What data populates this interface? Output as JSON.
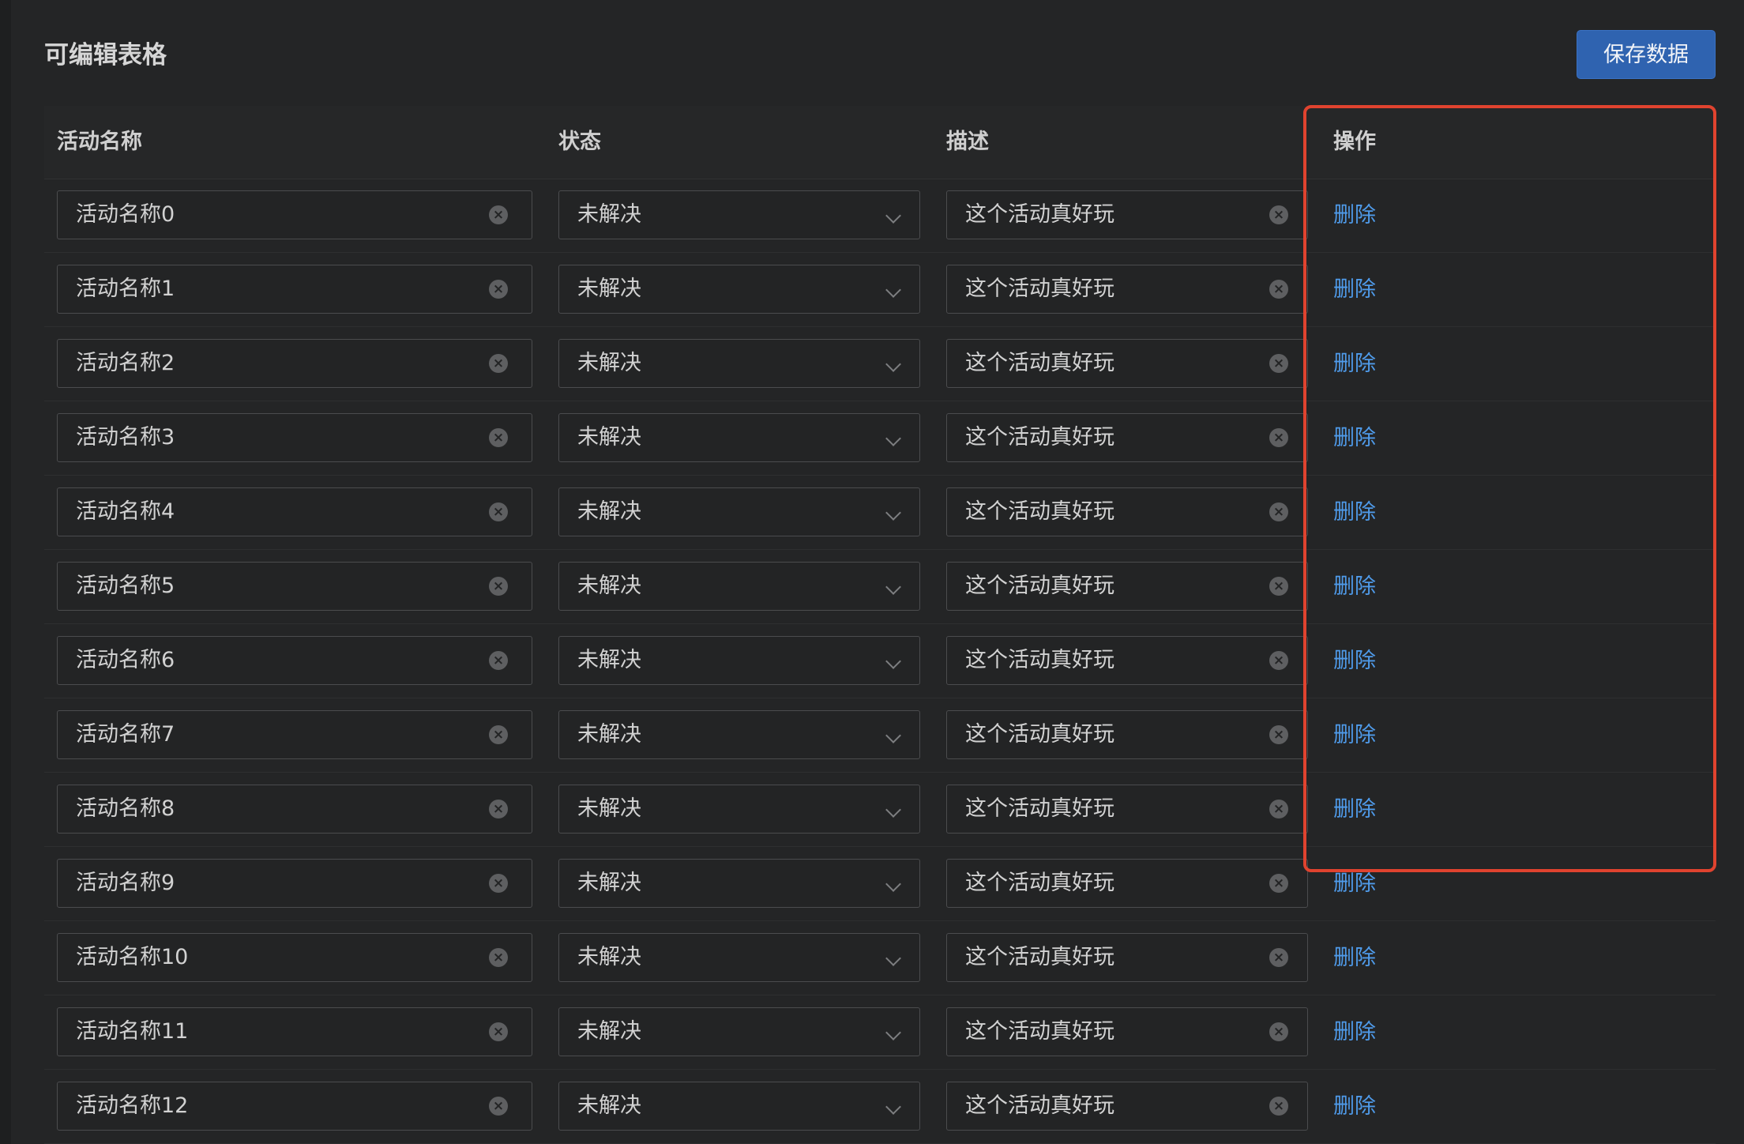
{
  "page": {
    "title": "可编辑表格",
    "save_button": "保存数据"
  },
  "table": {
    "headers": {
      "name": "活动名称",
      "status": "状态",
      "desc": "描述",
      "action": "操作"
    },
    "rows": [
      {
        "name": "活动名称0",
        "status": "未解决",
        "desc": "这个活动真好玩",
        "action": "删除"
      },
      {
        "name": "活动名称1",
        "status": "未解决",
        "desc": "这个活动真好玩",
        "action": "删除"
      },
      {
        "name": "活动名称2",
        "status": "未解决",
        "desc": "这个活动真好玩",
        "action": "删除"
      },
      {
        "name": "活动名称3",
        "status": "未解决",
        "desc": "这个活动真好玩",
        "action": "删除"
      },
      {
        "name": "活动名称4",
        "status": "未解决",
        "desc": "这个活动真好玩",
        "action": "删除"
      },
      {
        "name": "活动名称5",
        "status": "未解决",
        "desc": "这个活动真好玩",
        "action": "删除"
      },
      {
        "name": "活动名称6",
        "status": "未解决",
        "desc": "这个活动真好玩",
        "action": "删除"
      },
      {
        "name": "活动名称7",
        "status": "未解决",
        "desc": "这个活动真好玩",
        "action": "删除"
      },
      {
        "name": "活动名称8",
        "status": "未解决",
        "desc": "这个活动真好玩",
        "action": "删除"
      },
      {
        "name": "活动名称9",
        "status": "未解决",
        "desc": "这个活动真好玩",
        "action": "删除"
      },
      {
        "name": "活动名称10",
        "status": "未解决",
        "desc": "这个活动真好玩",
        "action": "删除"
      },
      {
        "name": "活动名称11",
        "status": "未解决",
        "desc": "这个活动真好玩",
        "action": "删除"
      },
      {
        "name": "活动名称12",
        "status": "未解决",
        "desc": "这个活动真好玩",
        "action": "删除"
      }
    ]
  },
  "colors": {
    "accent": "#2f63b0",
    "link": "#4f9bea",
    "highlight": "#e0432f",
    "background": "#242526"
  },
  "icons": {
    "clear": "clear-circle-icon",
    "dropdown": "chevron-down-icon"
  }
}
